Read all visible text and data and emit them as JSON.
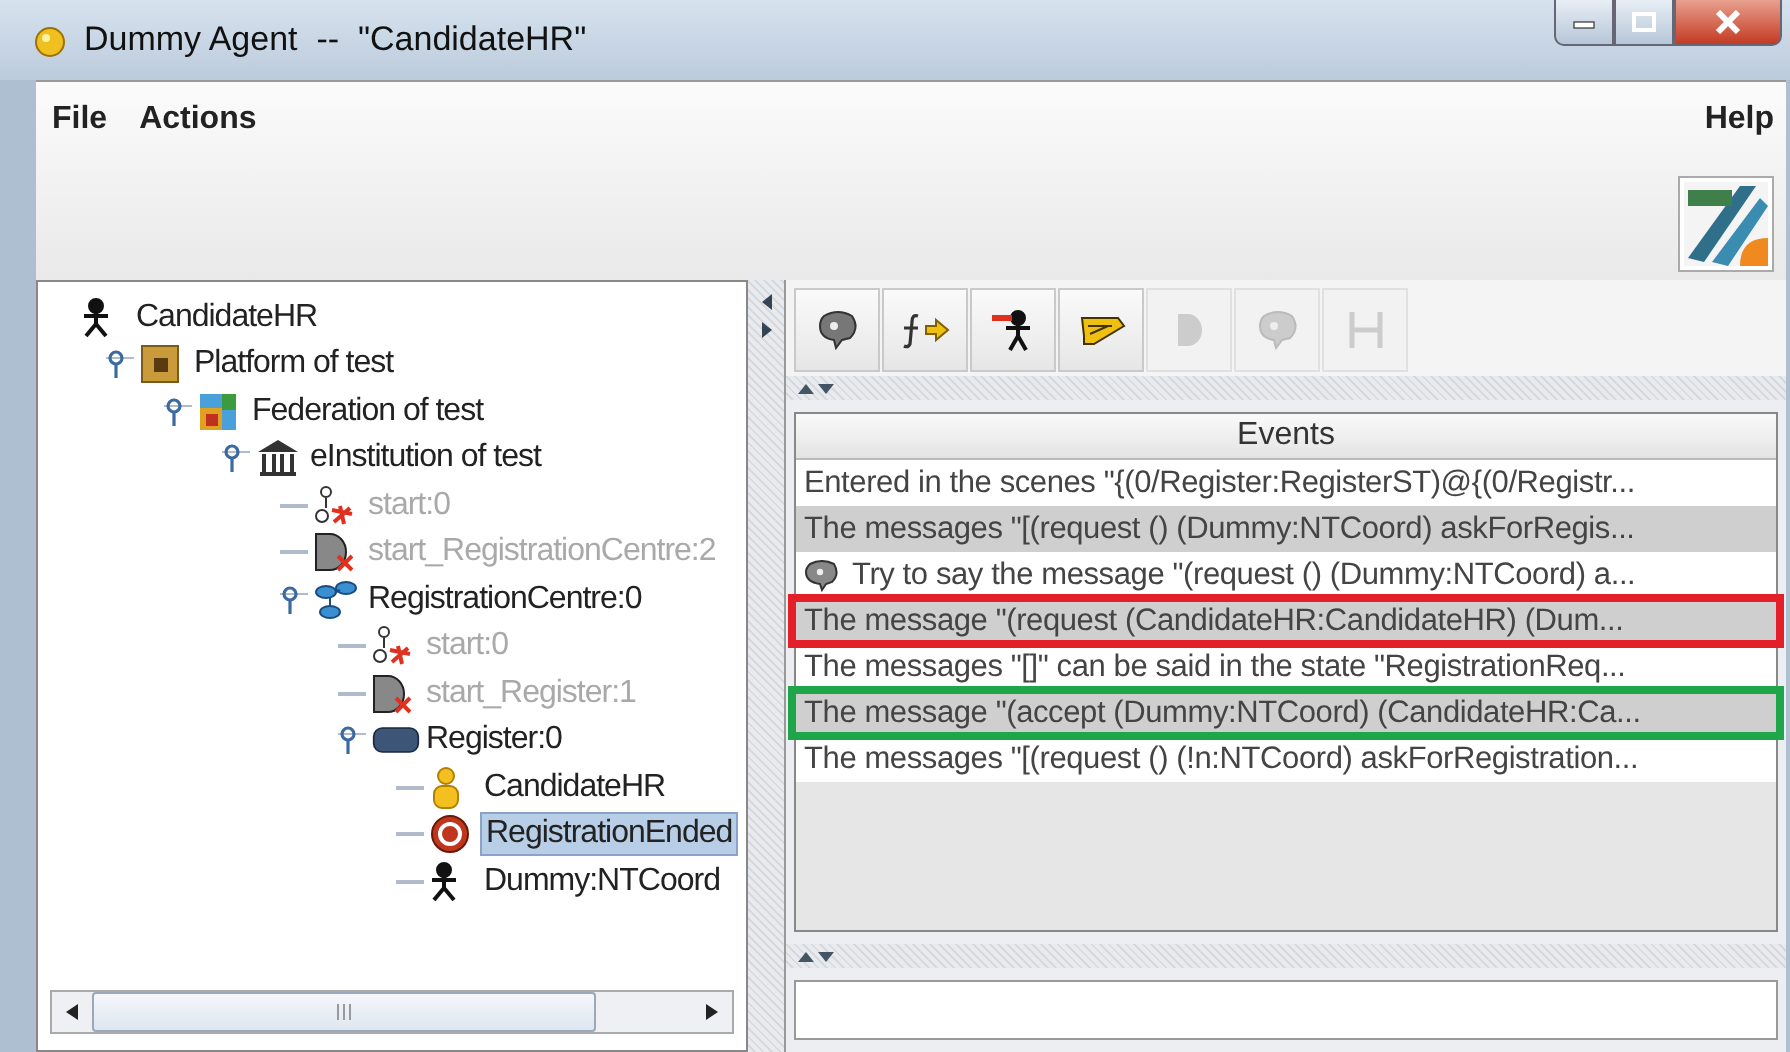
{
  "window": {
    "title": "Dummy Agent  --  \"CandidateHR\""
  },
  "menu": {
    "left": [
      "File",
      "Actions"
    ],
    "right": [
      "Help"
    ]
  },
  "tree": [
    {
      "label": "CandidateHR",
      "kind": "agent",
      "disabled": false,
      "selected": false,
      "children": [
        {
          "label": "Platform of test",
          "kind": "platform",
          "disabled": false,
          "selected": false,
          "expanded": true,
          "children": [
            {
              "label": "Federation of test",
              "kind": "federation",
              "disabled": false,
              "selected": false,
              "expanded": true,
              "children": [
                {
                  "label": "eInstitution of test",
                  "kind": "institution",
                  "disabled": false,
                  "selected": false,
                  "expanded": true,
                  "children": [
                    {
                      "label": "start:0",
                      "kind": "start",
                      "disabled": true,
                      "selected": false
                    },
                    {
                      "label": "start_RegistrationCentre:2",
                      "kind": "transition",
                      "disabled": true,
                      "selected": false
                    },
                    {
                      "label": "RegistrationCentre:0",
                      "kind": "scenes",
                      "disabled": false,
                      "selected": false,
                      "expanded": true,
                      "children": [
                        {
                          "label": "start:0",
                          "kind": "start",
                          "disabled": true,
                          "selected": false
                        },
                        {
                          "label": "start_Register:1",
                          "kind": "transition",
                          "disabled": true,
                          "selected": false
                        },
                        {
                          "label": "Register:0",
                          "kind": "scene",
                          "disabled": false,
                          "selected": false,
                          "expanded": true,
                          "children": [
                            {
                              "label": "CandidateHR",
                              "kind": "role",
                              "disabled": false,
                              "selected": false
                            },
                            {
                              "label": "RegistrationEnded",
                              "kind": "state",
                              "disabled": false,
                              "selected": true
                            },
                            {
                              "label": "Dummy:NTCoord",
                              "kind": "agent",
                              "disabled": false,
                              "selected": false
                            }
                          ]
                        }
                      ]
                    }
                  ]
                }
              ]
            }
          ]
        }
      ]
    }
  ],
  "toolbar": [
    {
      "kind": "speech",
      "disabled": false
    },
    {
      "kind": "function",
      "disabled": false
    },
    {
      "kind": "figure",
      "disabled": false
    },
    {
      "kind": "pen",
      "disabled": false
    },
    {
      "kind": "door",
      "disabled": true
    },
    {
      "kind": "speech",
      "disabled": true
    },
    {
      "kind": "bracket",
      "disabled": true
    }
  ],
  "events": {
    "header": "Events",
    "rows": [
      {
        "text": "Entered in the scenes \"{(0/Register:RegisterST)@{(0/Registr...",
        "kind": "plain"
      },
      {
        "text": "The messages \"[(request () (Dummy:NTCoord) askForRegis...",
        "kind": "plain"
      },
      {
        "text": "Try to say the message \"(request () (Dummy:NTCoord) a...",
        "kind": "speech"
      },
      {
        "text": "The message \"(request (CandidateHR:CandidateHR) (Dum...",
        "kind": "plain",
        "color": "#e3202a"
      },
      {
        "text": "The messages \"[]\" can be said in the state \"RegistrationReq...",
        "kind": "plain"
      },
      {
        "text": "The message \"(accept (Dummy:NTCoord) (CandidateHR:Ca...",
        "kind": "plain",
        "color": "#1fa64a"
      },
      {
        "text": "The messages \"[(request () (!n:NTCoord) askForRegistration...",
        "kind": "plain"
      }
    ]
  }
}
